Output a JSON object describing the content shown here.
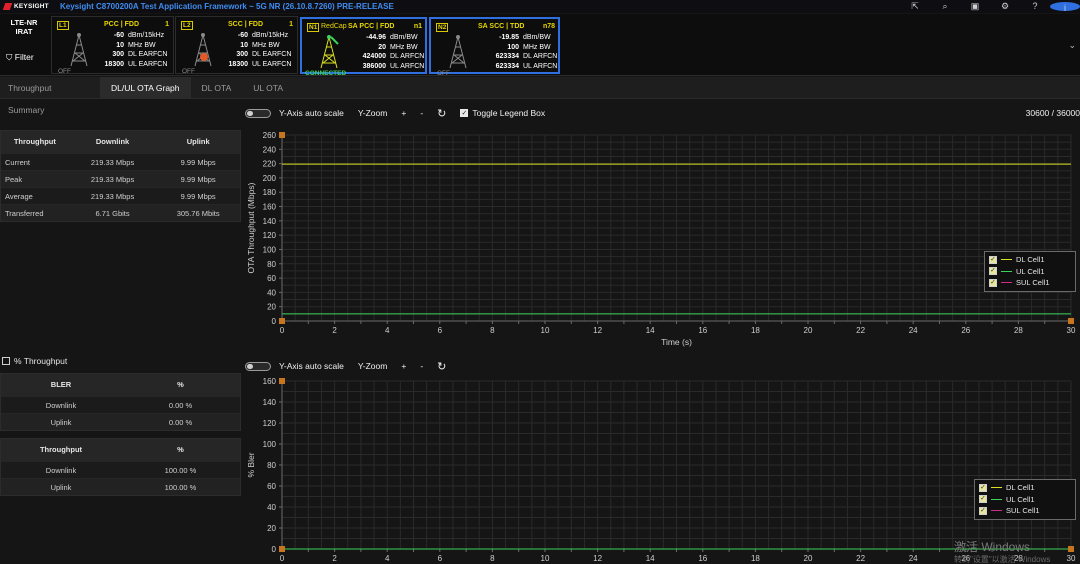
{
  "titlebar": {
    "brand": "KEYSIGHT",
    "title": "Keysight C8700200A Test Application Framework ~ 5G NR (26.10.8.7260) PRE-RELEASE",
    "icons": [
      "export-icon",
      "search-icon",
      "screenshot-icon",
      "gear-icon",
      "help-icon",
      "info-icon"
    ]
  },
  "cellbar": {
    "lte_label_1": "LTE-NR",
    "lte_label_2": "IRAT",
    "filter_label": "Filter",
    "cells": [
      {
        "tag": "L1",
        "name": "PCC  |  FDD",
        "num": "1",
        "vals": [
          "-60",
          "10",
          "300",
          "18300"
        ],
        "units": [
          "dBm/15kHz",
          "MHz BW",
          "DL EARFCN",
          "UL EARFCN"
        ],
        "state": "OFF"
      },
      {
        "tag": "L2",
        "name": "SCC  |  FDD",
        "num": "1",
        "vals": [
          "-60",
          "10",
          "300",
          "18300"
        ],
        "units": [
          "dBm/15kHz",
          "MHz BW",
          "DL EARFCN",
          "UL EARFCN"
        ],
        "state": "OFF"
      },
      {
        "tag": "N1",
        "prefix": "RedCap",
        "name": "SA PCC | FDD",
        "num": "n1",
        "vals": [
          "-44.96",
          "20",
          "424000",
          "386000"
        ],
        "units": [
          "dBm/BW",
          "MHz BW",
          "DL ARFCN",
          "UL ARFCN"
        ],
        "state": "CONNECTED"
      },
      {
        "tag": "N2",
        "name": "SA SCC | TDD",
        "num": "n78",
        "vals": [
          "-19.85",
          "100",
          "623334",
          "623334"
        ],
        "units": [
          "dBm/BW",
          "MHz BW",
          "DL ARFCN",
          "UL ARFCN"
        ],
        "state": "OFF"
      }
    ]
  },
  "tabs": [
    {
      "label": "Throughput Summary",
      "selected": false
    },
    {
      "label": "DL/UL OTA Graph",
      "selected": true
    },
    {
      "label": "DL OTA",
      "selected": false
    },
    {
      "label": "UL OTA",
      "selected": false
    }
  ],
  "throughput_table": {
    "headers": [
      "Throughput",
      "Downlink",
      "Uplink"
    ],
    "rows": [
      [
        "Current",
        "219.33 Mbps",
        "9.99 Mbps"
      ],
      [
        "Peak",
        "219.33 Mbps",
        "9.99 Mbps"
      ],
      [
        "Average",
        "219.33 Mbps",
        "9.99 Mbps"
      ],
      [
        "Transferred",
        "6.71 Gbits",
        "305.76 Mbits"
      ]
    ]
  },
  "pct_throughput_label": "% Throughput",
  "bler_table": {
    "headers": [
      "BLER",
      "%"
    ],
    "rows": [
      [
        "Downlink",
        "0.00 %"
      ],
      [
        "Uplink",
        "0.00 %"
      ]
    ]
  },
  "pct_table": {
    "headers": [
      "Throughput",
      "%"
    ],
    "rows": [
      [
        "Downlink",
        "100.00 %"
      ],
      [
        "Uplink",
        "100.00 %"
      ]
    ]
  },
  "toolbar_top": {
    "autoscale": "Y-Axis auto scale",
    "yzoom": "Y-Zoom",
    "plus": "+",
    "minus": "-",
    "legend_toggle": "Toggle Legend Box",
    "counter": "30600 / 36000"
  },
  "toolbar_bottom": {
    "autoscale": "Y-Axis auto scale",
    "yzoom": "Y-Zoom",
    "plus": "+",
    "minus": "-"
  },
  "colors": {
    "dl": "#d9e021",
    "ul": "#3bd35a",
    "sul": "#d02a8a",
    "accent": "#2f6fe0"
  },
  "chart_data": [
    {
      "type": "line",
      "xlabel": "Time (s)",
      "ylabel": "OTA Throughput (Mbps)",
      "xlim": [
        0,
        30
      ],
      "ylim": [
        0,
        260
      ],
      "xticks": [
        0,
        1,
        2,
        3,
        4,
        5,
        6,
        7,
        8,
        9,
        10,
        11,
        12,
        13,
        14,
        15,
        16,
        17,
        18,
        19,
        20,
        21,
        22,
        23,
        24,
        25,
        26,
        27,
        28,
        29,
        30
      ],
      "xticklabels": [
        0,
        2,
        4,
        6,
        8,
        10,
        12,
        14,
        16,
        18,
        20,
        22,
        24,
        26,
        28,
        30
      ],
      "yticks": [
        0,
        20,
        40,
        60,
        80,
        100,
        120,
        140,
        160,
        180,
        200,
        220,
        240,
        260
      ],
      "grid": true,
      "legend_placement": "right",
      "series": [
        {
          "name": "DL Cell1",
          "x": [
            0,
            30
          ],
          "values": [
            219.33,
            219.33
          ]
        },
        {
          "name": "UL Cell1",
          "x": [
            0,
            30
          ],
          "values": [
            9.99,
            9.99
          ]
        },
        {
          "name": "SUL Cell1",
          "x": [],
          "values": []
        }
      ]
    },
    {
      "type": "line",
      "xlabel": "",
      "ylabel": "% Bler",
      "xlim": [
        0,
        30
      ],
      "ylim": [
        0,
        160
      ],
      "xticklabels": [
        0,
        2,
        4,
        6,
        8,
        10,
        12,
        14,
        16,
        18,
        20,
        22,
        24,
        26,
        28,
        30
      ],
      "yticks": [
        0,
        20,
        40,
        60,
        80,
        100,
        120,
        140,
        160
      ],
      "grid": true,
      "legend_placement": "right",
      "series": [
        {
          "name": "DL Cell1",
          "x": [
            0,
            30
          ],
          "values": [
            0,
            0
          ]
        },
        {
          "name": "UL Cell1",
          "x": [
            0,
            30
          ],
          "values": [
            0,
            0
          ]
        },
        {
          "name": "SUL Cell1",
          "x": [],
          "values": []
        }
      ]
    }
  ],
  "watermark": {
    "line1": "激活 Windows",
    "line2": "转到\"设置\"以激活 Windows"
  }
}
